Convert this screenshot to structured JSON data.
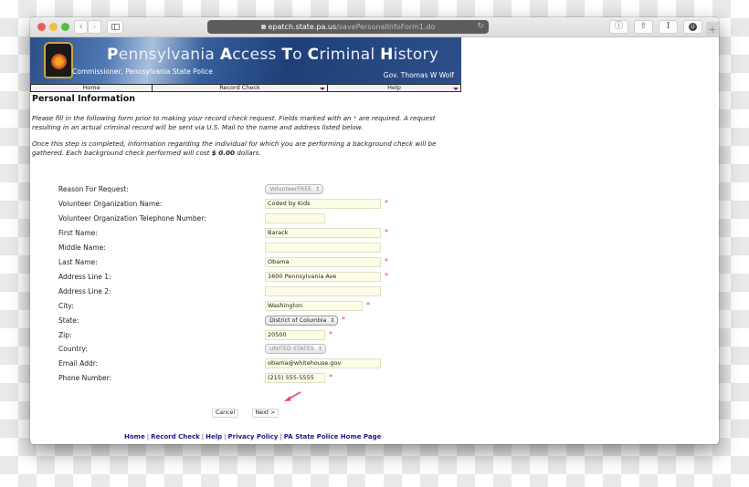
{
  "browser": {
    "url_host": "epatch.state.pa.us",
    "url_path": "/savePersonalInfoForm1.do",
    "back_icon": "chevron-left-icon",
    "forward_icon": "chevron-right-icon",
    "sidebar_icon": "sidebar-icon",
    "reload_icon": "reload-icon",
    "toolbar_icons": [
      "info-icon",
      "share-icon",
      "reader-cursor-icon",
      "extension-icon"
    ],
    "extension_label": "U",
    "new_tab_label": "+"
  },
  "banner": {
    "title_parts": [
      {
        "cap": "P",
        "rest": "ennsylvania "
      },
      {
        "cap": "A",
        "rest": "ccess "
      },
      {
        "cap": "T",
        "rest": "o "
      },
      {
        "cap": "C",
        "rest": "riminal "
      },
      {
        "cap": "H",
        "rest": "istory"
      }
    ],
    "subtitle": "Commissioner, Pennsylvania State Police",
    "governor": "Gov. Thomas W Wolf"
  },
  "menu": {
    "items": [
      {
        "label": "Home",
        "has_dropdown": false
      },
      {
        "label": "Record Check",
        "has_dropdown": true
      },
      {
        "label": "Help",
        "has_dropdown": true
      }
    ]
  },
  "page": {
    "title": "Personal Information",
    "intro1_a": "Please fill in the following form prior to making your record check request. Fields marked with an ",
    "intro1_star": "*",
    "intro1_b": " are required. A request resulting in an actual criminal record will be sent via U.S. Mail to the name and address listed below.",
    "intro2_a": "Once this step is completed, information regarding the individual for which you are performing a background check will be gathered. Each background check performed will cost ",
    "intro2_cost": "$ 0.00",
    "intro2_b": " dollars."
  },
  "form": {
    "required_mark": "*",
    "fields": [
      {
        "label": "Reason For Request:",
        "type": "select",
        "value": "VolunteerFREE",
        "disabled": true,
        "required": false
      },
      {
        "label": "Volunteer Organization Name:",
        "type": "text",
        "value": "Coded by Kids",
        "required": true
      },
      {
        "label": "Volunteer Organization Telephone Number:",
        "type": "text",
        "value": "",
        "required": false
      },
      {
        "label": "First Name:",
        "type": "text",
        "value": "Barack",
        "required": true
      },
      {
        "label": "Middle Name:",
        "type": "text",
        "value": "",
        "required": false
      },
      {
        "label": "Last Name:",
        "type": "text",
        "value": "Obama",
        "required": true
      },
      {
        "label": "Address Line 1:",
        "type": "text",
        "value": "1600 Pennsylvania Ave",
        "required": true
      },
      {
        "label": "Address Line 2:",
        "type": "text",
        "value": "",
        "required": false
      },
      {
        "label": "City:",
        "type": "text",
        "value": "Washington",
        "required": true
      },
      {
        "label": "State:",
        "type": "select",
        "value": "District of Columbia",
        "disabled": false,
        "required": true
      },
      {
        "label": "Zip:",
        "type": "text",
        "value": "20500",
        "required": true
      },
      {
        "label": "Country:",
        "type": "select",
        "value": "UNITED STATES",
        "disabled": true,
        "required": false
      },
      {
        "label": "Email Addr:",
        "type": "text",
        "value": "obama@whitehouse.gov",
        "required": false
      },
      {
        "label": "Phone Number:",
        "type": "text",
        "value": "(215) 555-5555",
        "required": true
      }
    ],
    "cancel_label": "Cancel",
    "next_label": "Next >",
    "annotation_arrow_color": "#e8457a"
  },
  "footer": {
    "links": [
      "Home",
      "Record Check",
      "Help",
      "Privacy Policy",
      "PA State Police Home Page"
    ],
    "separator": "|"
  }
}
